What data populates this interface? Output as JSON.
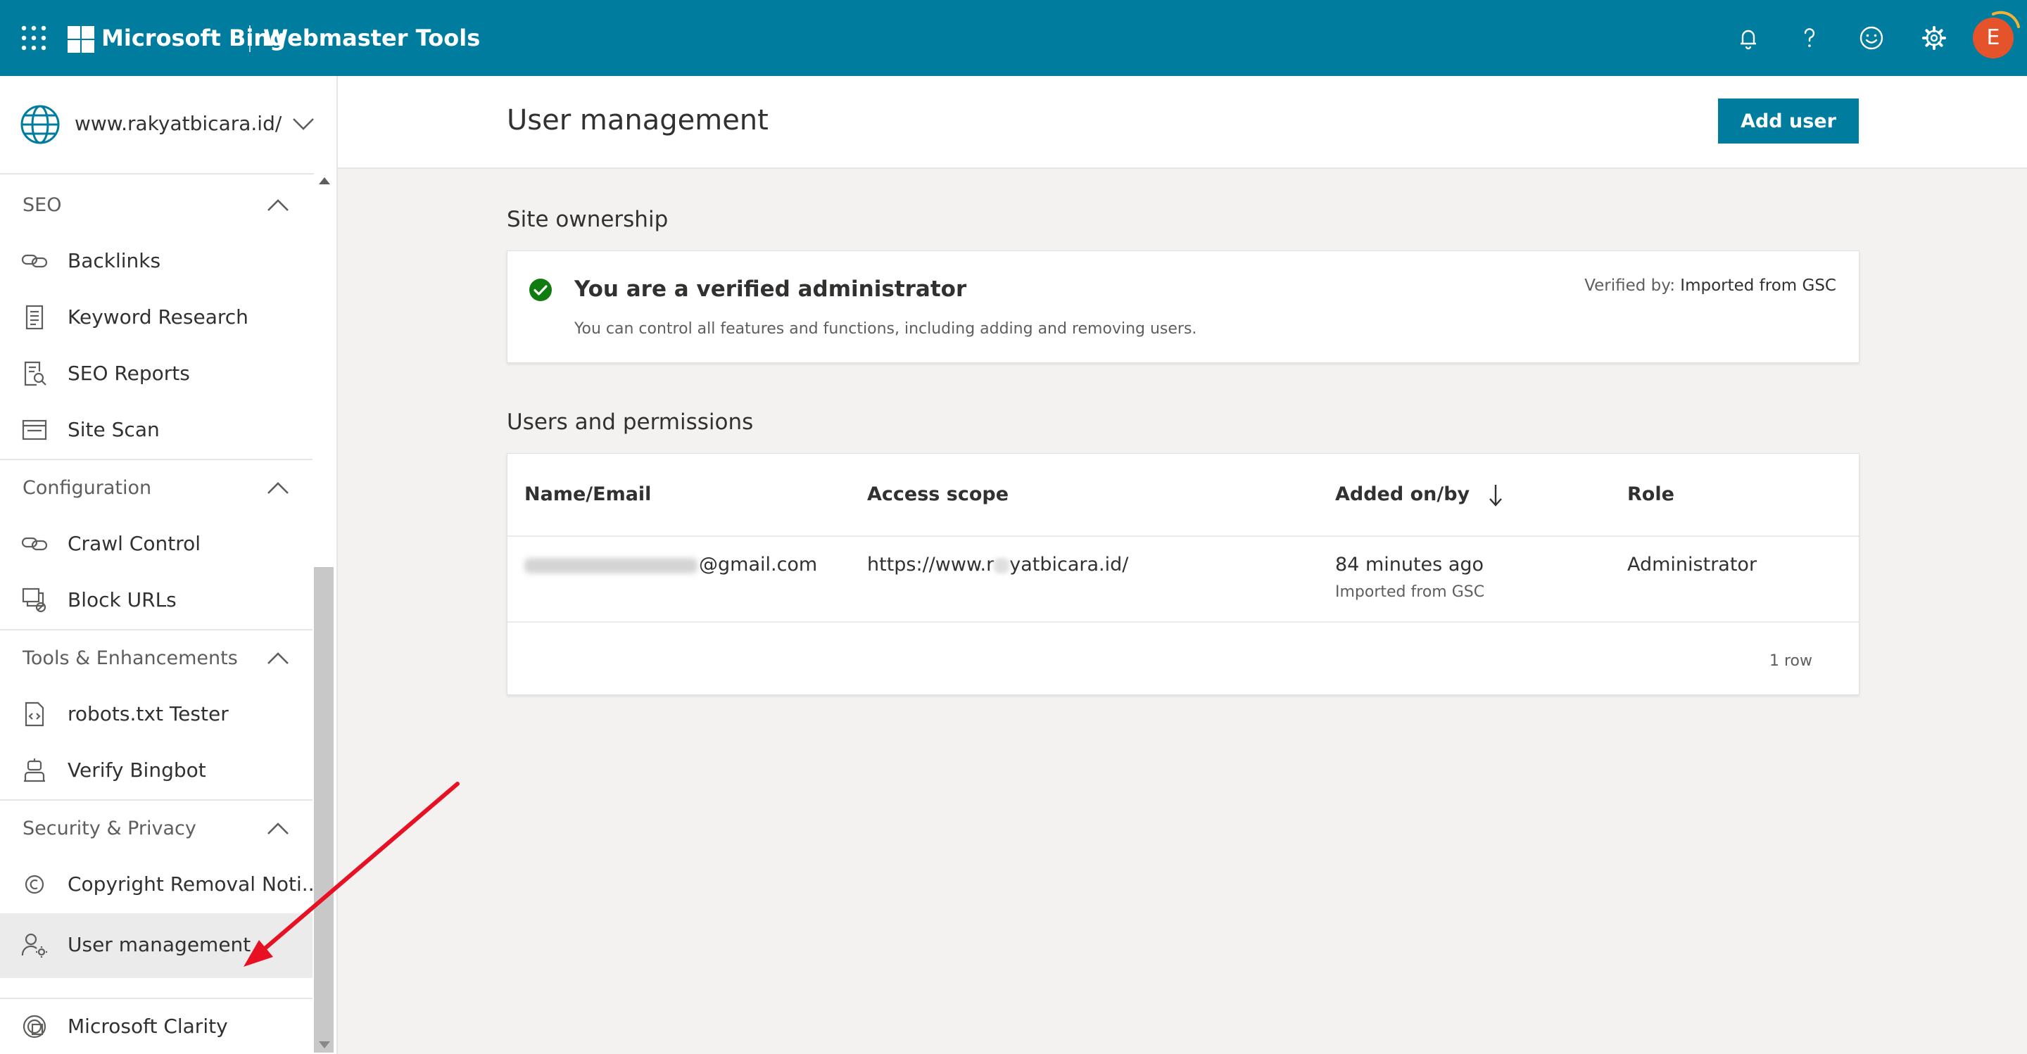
{
  "topbar": {
    "brand": "Microsoft Bing",
    "product": "Webmaster Tools",
    "avatar_initial": "E",
    "icons": [
      "waffle-icon",
      "notification-bell-icon",
      "help-icon",
      "feedback-smiley-icon",
      "settings-gear-icon"
    ]
  },
  "sidebar": {
    "site": "www.rakyatbicara.id/",
    "sections": [
      {
        "label": "SEO",
        "items": [
          "Backlinks",
          "Keyword Research",
          "SEO Reports",
          "Site Scan"
        ]
      },
      {
        "label": "Configuration",
        "items": [
          "Crawl Control",
          "Block URLs"
        ]
      },
      {
        "label": "Tools & Enhancements",
        "items": [
          "robots.txt Tester",
          "Verify Bingbot"
        ]
      },
      {
        "label": "Security & Privacy",
        "items": [
          "Copyright Removal Noti...",
          "User management"
        ]
      }
    ],
    "extra_item": "Microsoft Clarity",
    "active_item": "User management"
  },
  "header": {
    "title": "User management",
    "add_user_label": "Add user"
  },
  "ownership": {
    "section_title": "Site ownership",
    "heading": "You are a verified administrator",
    "description": "You can control all features and functions, including adding and removing users.",
    "verified_by_label": "Verified by:",
    "verified_by_value": "Imported from GSC"
  },
  "users": {
    "section_title": "Users and permissions",
    "columns": [
      "Name/Email",
      "Access scope",
      "Added on/by",
      "Role"
    ],
    "rows": [
      {
        "email_suffix": "@gmail.com",
        "scope_prefix": "https://www.r",
        "scope_suffix": "yatbicara.id/",
        "added": "84 minutes ago",
        "added_by": "Imported from GSC",
        "role": "Administrator"
      }
    ],
    "row_count": "1 row"
  },
  "colors": {
    "topbar": "#007c9f",
    "primary_button": "#007c9f",
    "avatar": "#e5532b",
    "check": "#107c10",
    "annotation_arrow": "#e81123"
  }
}
